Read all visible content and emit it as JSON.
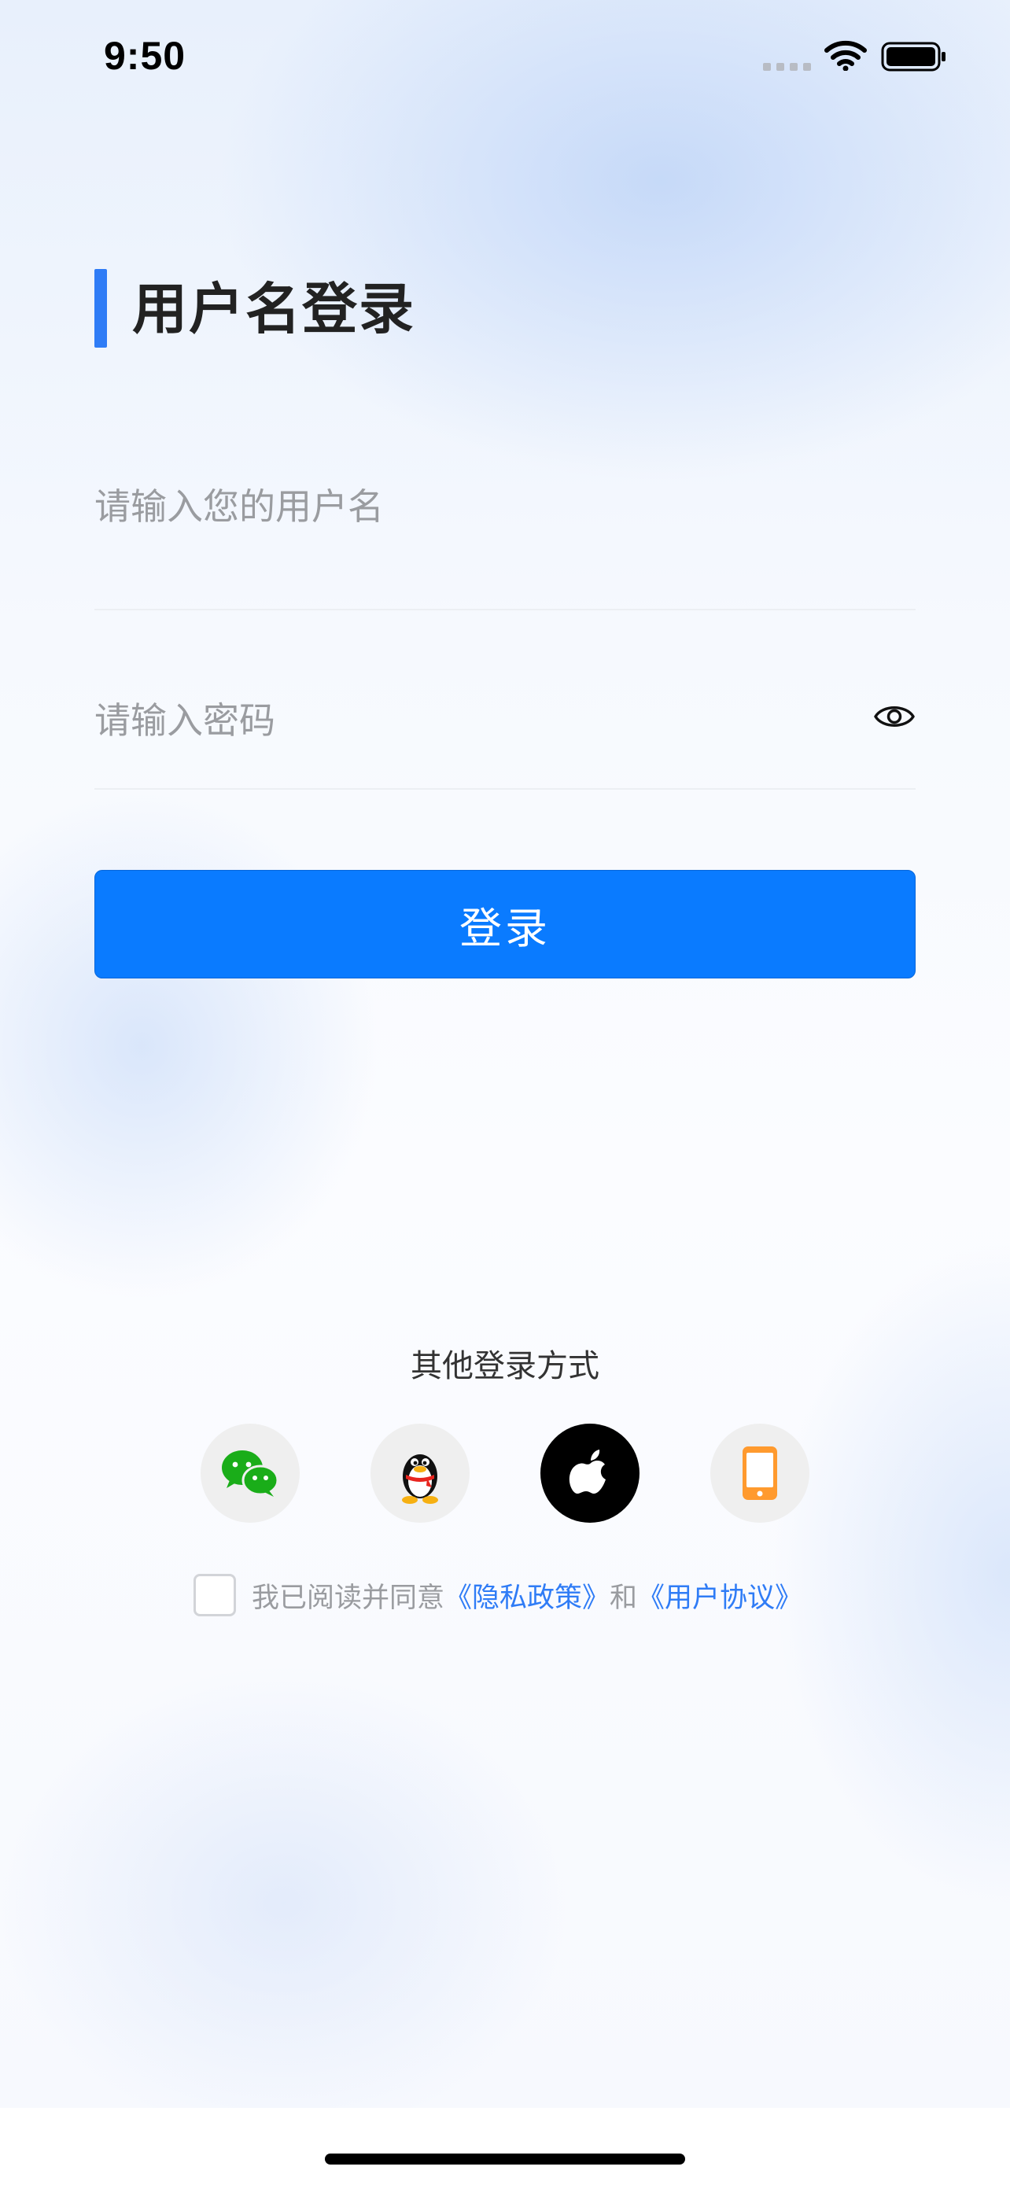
{
  "status_bar": {
    "time": "9:50"
  },
  "header": {
    "title": "用户名登录",
    "accent_color": "#2f7cf6"
  },
  "form": {
    "username_placeholder": "请输入您的用户名",
    "username_value": "",
    "password_placeholder": "请输入密码",
    "password_value": "",
    "password_toggle_icon": "eye-icon",
    "login_label": "登录",
    "login_color": "#0a7bff"
  },
  "other_login": {
    "title": "其他登录方式",
    "options": [
      {
        "name": "wechat",
        "icon": "wechat-icon",
        "color": "#1aad19"
      },
      {
        "name": "qq",
        "icon": "qq-icon",
        "color": "#000000"
      },
      {
        "name": "apple",
        "icon": "apple-icon",
        "color": "#000000"
      },
      {
        "name": "phone",
        "icon": "phone-icon",
        "color": "#ff9a2e"
      }
    ]
  },
  "agreement": {
    "checked": false,
    "prefix": "我已阅读并同意",
    "privacy_link": "《隐私政策》",
    "conjunction": "和",
    "user_agreement_link": "《用户协议》",
    "link_color": "#2f7cf6"
  }
}
